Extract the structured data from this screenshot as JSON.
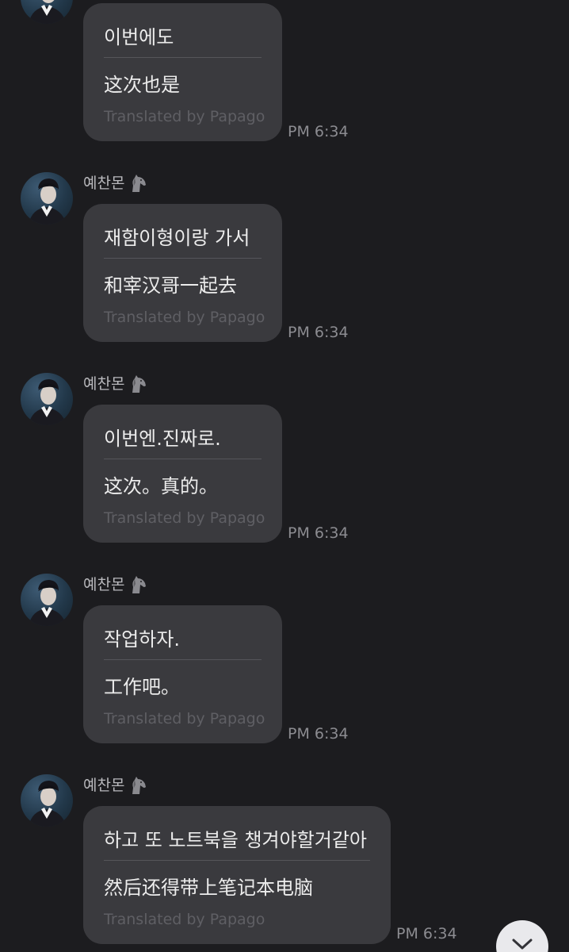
{
  "translation_credit": "Translated by Papago",
  "messages": [
    {
      "sender": "",
      "original": "이번에도",
      "translated": "这次也是",
      "time": "PM 6:34"
    },
    {
      "sender": "예찬몬",
      "original": "재함이형이랑 가서",
      "translated": "和宰汉哥一起去",
      "time": "PM 6:34"
    },
    {
      "sender": "예찬몬",
      "original": "이번엔.진짜로.",
      "translated": "这次。真的。",
      "time": "PM 6:34"
    },
    {
      "sender": "예찬몬",
      "original": "작업하자.",
      "translated": "工作吧。",
      "time": "PM 6:34"
    },
    {
      "sender": "예찬몬",
      "original": "하고 또 노트북을 챙겨야할거같아",
      "translated": "然后还得带上笔记本电脑",
      "time": "PM 6:34"
    }
  ],
  "icons": {
    "sender_badge": "horse-icon",
    "scroll_down": "chevron-down-icon"
  },
  "colors": {
    "background": "#1c1c1f",
    "bubble": "#3a3a3e",
    "text": "#ececec",
    "credit": "#5f5f64",
    "time": "#8c8c91"
  }
}
